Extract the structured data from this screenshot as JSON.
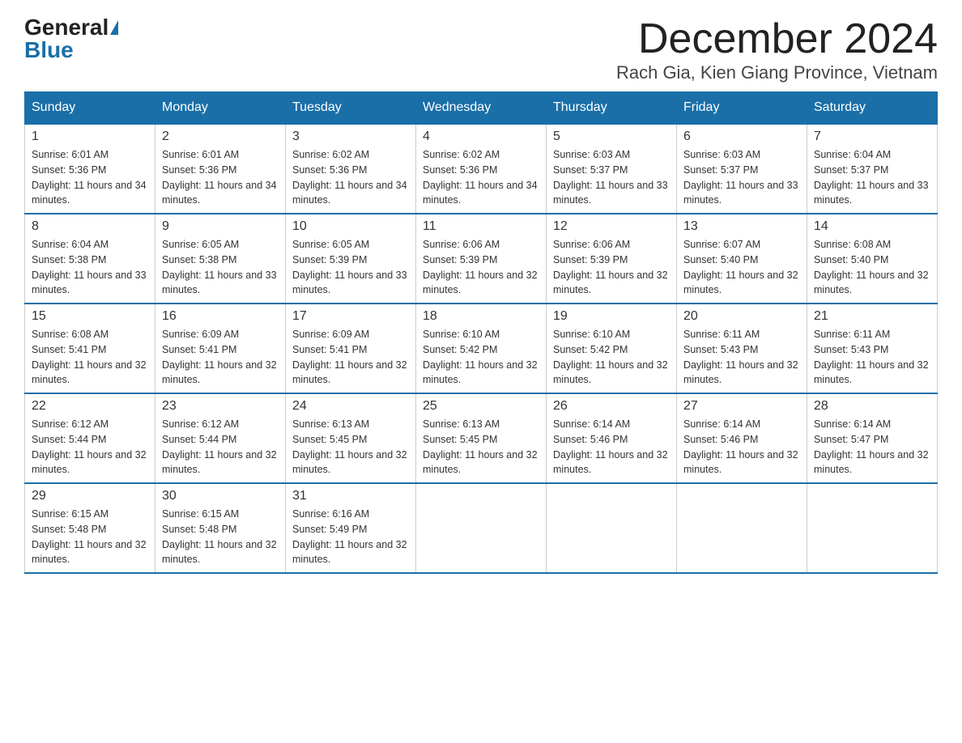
{
  "header": {
    "logo_general": "General",
    "logo_blue": "Blue",
    "month_title": "December 2024",
    "location": "Rach Gia, Kien Giang Province, Vietnam"
  },
  "days_of_week": [
    "Sunday",
    "Monday",
    "Tuesday",
    "Wednesday",
    "Thursday",
    "Friday",
    "Saturday"
  ],
  "weeks": [
    [
      {
        "day": "1",
        "sunrise": "6:01 AM",
        "sunset": "5:36 PM",
        "daylight": "11 hours and 34 minutes."
      },
      {
        "day": "2",
        "sunrise": "6:01 AM",
        "sunset": "5:36 PM",
        "daylight": "11 hours and 34 minutes."
      },
      {
        "day": "3",
        "sunrise": "6:02 AM",
        "sunset": "5:36 PM",
        "daylight": "11 hours and 34 minutes."
      },
      {
        "day": "4",
        "sunrise": "6:02 AM",
        "sunset": "5:36 PM",
        "daylight": "11 hours and 34 minutes."
      },
      {
        "day": "5",
        "sunrise": "6:03 AM",
        "sunset": "5:37 PM",
        "daylight": "11 hours and 33 minutes."
      },
      {
        "day": "6",
        "sunrise": "6:03 AM",
        "sunset": "5:37 PM",
        "daylight": "11 hours and 33 minutes."
      },
      {
        "day": "7",
        "sunrise": "6:04 AM",
        "sunset": "5:37 PM",
        "daylight": "11 hours and 33 minutes."
      }
    ],
    [
      {
        "day": "8",
        "sunrise": "6:04 AM",
        "sunset": "5:38 PM",
        "daylight": "11 hours and 33 minutes."
      },
      {
        "day": "9",
        "sunrise": "6:05 AM",
        "sunset": "5:38 PM",
        "daylight": "11 hours and 33 minutes."
      },
      {
        "day": "10",
        "sunrise": "6:05 AM",
        "sunset": "5:39 PM",
        "daylight": "11 hours and 33 minutes."
      },
      {
        "day": "11",
        "sunrise": "6:06 AM",
        "sunset": "5:39 PM",
        "daylight": "11 hours and 32 minutes."
      },
      {
        "day": "12",
        "sunrise": "6:06 AM",
        "sunset": "5:39 PM",
        "daylight": "11 hours and 32 minutes."
      },
      {
        "day": "13",
        "sunrise": "6:07 AM",
        "sunset": "5:40 PM",
        "daylight": "11 hours and 32 minutes."
      },
      {
        "day": "14",
        "sunrise": "6:08 AM",
        "sunset": "5:40 PM",
        "daylight": "11 hours and 32 minutes."
      }
    ],
    [
      {
        "day": "15",
        "sunrise": "6:08 AM",
        "sunset": "5:41 PM",
        "daylight": "11 hours and 32 minutes."
      },
      {
        "day": "16",
        "sunrise": "6:09 AM",
        "sunset": "5:41 PM",
        "daylight": "11 hours and 32 minutes."
      },
      {
        "day": "17",
        "sunrise": "6:09 AM",
        "sunset": "5:41 PM",
        "daylight": "11 hours and 32 minutes."
      },
      {
        "day": "18",
        "sunrise": "6:10 AM",
        "sunset": "5:42 PM",
        "daylight": "11 hours and 32 minutes."
      },
      {
        "day": "19",
        "sunrise": "6:10 AM",
        "sunset": "5:42 PM",
        "daylight": "11 hours and 32 minutes."
      },
      {
        "day": "20",
        "sunrise": "6:11 AM",
        "sunset": "5:43 PM",
        "daylight": "11 hours and 32 minutes."
      },
      {
        "day": "21",
        "sunrise": "6:11 AM",
        "sunset": "5:43 PM",
        "daylight": "11 hours and 32 minutes."
      }
    ],
    [
      {
        "day": "22",
        "sunrise": "6:12 AM",
        "sunset": "5:44 PM",
        "daylight": "11 hours and 32 minutes."
      },
      {
        "day": "23",
        "sunrise": "6:12 AM",
        "sunset": "5:44 PM",
        "daylight": "11 hours and 32 minutes."
      },
      {
        "day": "24",
        "sunrise": "6:13 AM",
        "sunset": "5:45 PM",
        "daylight": "11 hours and 32 minutes."
      },
      {
        "day": "25",
        "sunrise": "6:13 AM",
        "sunset": "5:45 PM",
        "daylight": "11 hours and 32 minutes."
      },
      {
        "day": "26",
        "sunrise": "6:14 AM",
        "sunset": "5:46 PM",
        "daylight": "11 hours and 32 minutes."
      },
      {
        "day": "27",
        "sunrise": "6:14 AM",
        "sunset": "5:46 PM",
        "daylight": "11 hours and 32 minutes."
      },
      {
        "day": "28",
        "sunrise": "6:14 AM",
        "sunset": "5:47 PM",
        "daylight": "11 hours and 32 minutes."
      }
    ],
    [
      {
        "day": "29",
        "sunrise": "6:15 AM",
        "sunset": "5:48 PM",
        "daylight": "11 hours and 32 minutes."
      },
      {
        "day": "30",
        "sunrise": "6:15 AM",
        "sunset": "5:48 PM",
        "daylight": "11 hours and 32 minutes."
      },
      {
        "day": "31",
        "sunrise": "6:16 AM",
        "sunset": "5:49 PM",
        "daylight": "11 hours and 32 minutes."
      },
      null,
      null,
      null,
      null
    ]
  ]
}
